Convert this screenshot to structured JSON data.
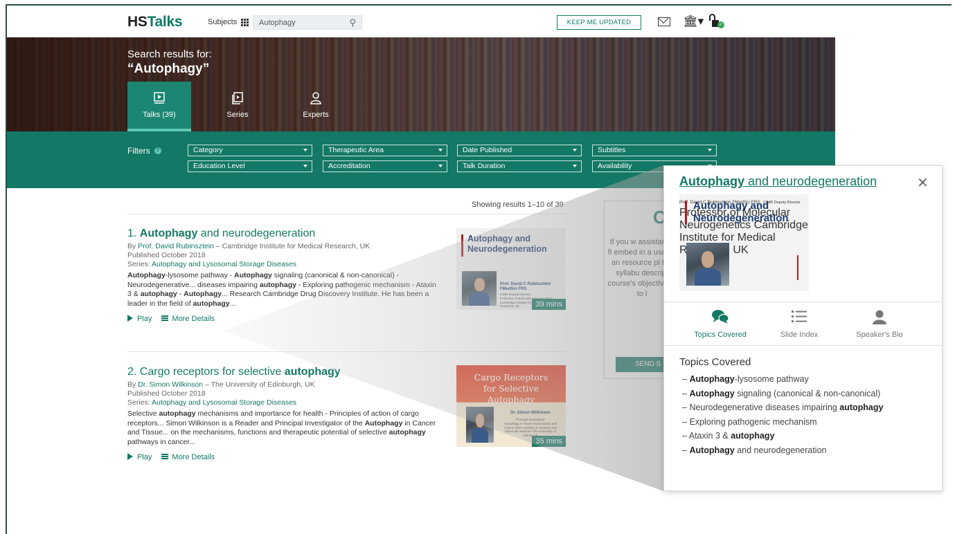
{
  "header": {
    "logo_hs": "HS",
    "logo_talks": "Talks",
    "subjects_label": "Subjects",
    "search_value": "Autophagy",
    "keep_updated": "KEEP ME UPDATED"
  },
  "hero": {
    "line1": "Search results for:",
    "line2": "“Autophagy”",
    "tabs": [
      {
        "label": "Talks (39)",
        "active": true
      },
      {
        "label": "Series",
        "active": false
      },
      {
        "label": "Experts",
        "active": false
      }
    ]
  },
  "filters": {
    "label": "Filters",
    "row1": [
      "Category",
      "Therapeutic Area",
      "Date Published",
      "Subtitles"
    ],
    "row2": [
      "Education Level",
      "Accreditation",
      "Talk Duration",
      "Availability"
    ]
  },
  "results": {
    "showing": "Showing results 1–10 of 39",
    "items": [
      {
        "number": "1.",
        "title_bold": "Autophagy",
        "title_rest": " and neurodegeneration",
        "by_prefix": "By ",
        "speaker": "Prof. David Rubinsztein",
        "affiliation": " – Cambridge Institute for Medical Research, UK",
        "published": "Published October 2018",
        "series_prefix": "Series: ",
        "series": "Autophagy and Lysosomal Storage Diseases",
        "desc": [
          {
            "t": "Autophagy",
            "b": true
          },
          {
            "t": "-lysosome pathway - ",
            "b": false
          },
          {
            "t": "Autophagy",
            "b": true
          },
          {
            "t": " signaling (canonical & non-canonical) - Neurodegenerative... diseases impairing ",
            "b": false
          },
          {
            "t": "autophagy",
            "b": true
          },
          {
            "t": " - Exploring pathogenic mechanism - Ataxin 3 & ",
            "b": false
          },
          {
            "t": "autophagy",
            "b": true
          },
          {
            "t": " - ",
            "b": false
          },
          {
            "t": "Autophagy",
            "b": true
          },
          {
            "t": "... Research Cambridge Drug Discovery Institute. He has been a leader in the field of ",
            "b": false
          },
          {
            "t": "autophagy",
            "b": true
          },
          {
            "t": "...",
            "b": false
          }
        ],
        "play": "Play",
        "details": "More Details",
        "thumb_title": "Autophagy and Neurodegeneration",
        "thumb_speaker": "Prof. David C Rubinsztein FMedSci FRS",
        "thumb_role": "CIMR Deputy Director",
        "thumb_role2": "Professor of Molecular Neurogenetics Cambridge Institute for Medical Research, UK",
        "duration": "39 mins"
      },
      {
        "number": "2.",
        "title_pre": "Cargo receptors for selective ",
        "title_bold": "autophagy",
        "by_prefix": "By ",
        "speaker": "Dr. Simon Wilkinson",
        "affiliation": " – The University of Edinburgh, UK",
        "published": "Published October 2018",
        "series_prefix": "Series: ",
        "series": "Autophagy and Lysosomal Storage Diseases",
        "desc": [
          {
            "t": "Selective ",
            "b": false
          },
          {
            "t": "autophagy",
            "b": true
          },
          {
            "t": " mechanisms and importance for health - Principles of action of cargo receptors... Simon Wilkinson is a Reader and Principal Investigator of the ",
            "b": false
          },
          {
            "t": "Autophagy",
            "b": true
          },
          {
            "t": " in Cancer and Tissue... on the mechanisms, functions and therapeutic potential of selective ",
            "b": false
          },
          {
            "t": "autophagy",
            "b": true
          },
          {
            "t": " pathways in cancer...",
            "b": false
          }
        ],
        "play": "Play",
        "details": "More Details",
        "thumb_title": "Cargo Receptors for Selective Autophagy",
        "thumb_speaker": "Dr. Simon Wilkinson",
        "thumb_role": "Principal Investigator",
        "thumb_role2": "Autophagy in Tissue Homeostasis and Cancer MRC Institute of Genetics and Molecular Medicine The University of Edinburgh",
        "duration": "35 mins"
      }
    ]
  },
  "promo": {
    "big": "C",
    "text": "If you w assistance fi embed in a use as an resource pl the syllabu descript course's objectives - to l",
    "button": "SEND S"
  },
  "popup": {
    "title_bold": "Autophagy",
    "title_rest": " and neurodegeneration",
    "thumb_title": "Autophagy and Neurodegeneration",
    "thumb_speaker": "Prof. David C Rubinsztein FMedSci FRS",
    "thumb_role": "CIMR Deputy Director",
    "thumb_role2": "Professor of Molecular Neurogenetics Cambridge Institute for Medical Research, UK",
    "tabs": [
      "Topics Covered",
      "Slide Index",
      "Speaker's Bio"
    ],
    "topics_heading": "Topics Covered",
    "topics": [
      [
        {
          "t": "Autophagy",
          "b": true
        },
        {
          "t": "-lysosome pathway",
          "b": false
        }
      ],
      [
        {
          "t": "Autophagy",
          "b": true
        },
        {
          "t": " signaling (canonical & non-canonical)",
          "b": false
        }
      ],
      [
        {
          "t": "Neurodegenerative diseases impairing ",
          "b": false
        },
        {
          "t": "autophagy",
          "b": true
        }
      ],
      [
        {
          "t": "Exploring pathogenic mechanism",
          "b": false
        }
      ],
      [
        {
          "t": "Ataxin 3 & ",
          "b": false
        },
        {
          "t": "autophagy",
          "b": true
        }
      ],
      [
        {
          "t": "Autophagy",
          "b": true
        },
        {
          "t": " and neurodegeneration",
          "b": false
        }
      ]
    ]
  },
  "colors": {
    "brand": "#137865",
    "accent": "#5ec9b3",
    "thumb_red": "#b31b1b",
    "thumb_blue": "#1d3b6e"
  },
  "icons": [
    "grid-icon",
    "search-icon",
    "mail-icon",
    "institution-icon",
    "lock-icon",
    "talks-icon",
    "series-icon",
    "experts-icon",
    "help-icon",
    "caret-down-icon",
    "play-icon",
    "menu-icon",
    "close-icon",
    "topics-icon",
    "slide-index-icon",
    "speaker-bio-icon"
  ]
}
